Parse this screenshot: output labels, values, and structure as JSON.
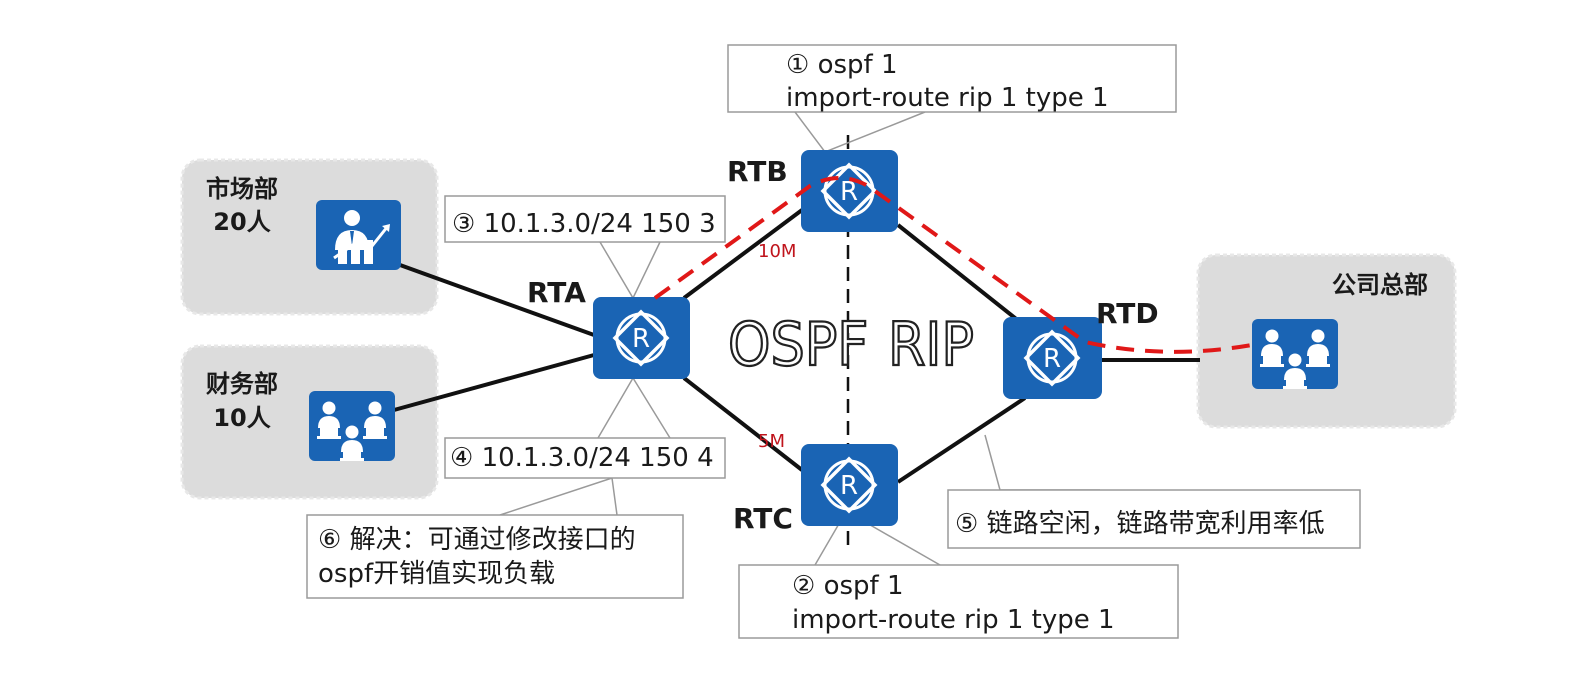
{
  "departments": {
    "market": {
      "name": "市场部",
      "count": "20人"
    },
    "finance": {
      "name": "财务部",
      "count": "10人"
    },
    "hq": {
      "name": "公司总部"
    }
  },
  "routers": {
    "rta": "RTA",
    "rtb": "RTB",
    "rtc": "RTC",
    "rtd": "RTD",
    "symbol": "R"
  },
  "zones": {
    "left": "OSPF",
    "right": "RIP"
  },
  "bandwidth": {
    "rta_rtb": "10M",
    "rta_rtc": "5M"
  },
  "callouts": {
    "c1": {
      "line1": "① ospf 1",
      "line2": "import-route rip 1 type 1"
    },
    "c2": {
      "line1": "② ospf 1",
      "line2": "import-route rip 1 type 1"
    },
    "c3": "③ 10.1.3.0/24 150 3",
    "c4": "④ 10.1.3.0/24 150 4",
    "c5": "⑤ 链路空闲，链路带宽利用率低",
    "c6": {
      "line1": "⑥  解决：可通过修改接口的",
      "line2": "ospf开销值实现负载"
    }
  },
  "colors": {
    "router_fill": "#1a64b4",
    "department_bg": "#dcdcdc",
    "traffic_path": "#e01818",
    "bandwidth_text": "#c0141c"
  },
  "icons": {
    "router": "router-icon",
    "market": "businessman-chart-icon",
    "finance": "team-icon",
    "hq": "team-icon"
  }
}
